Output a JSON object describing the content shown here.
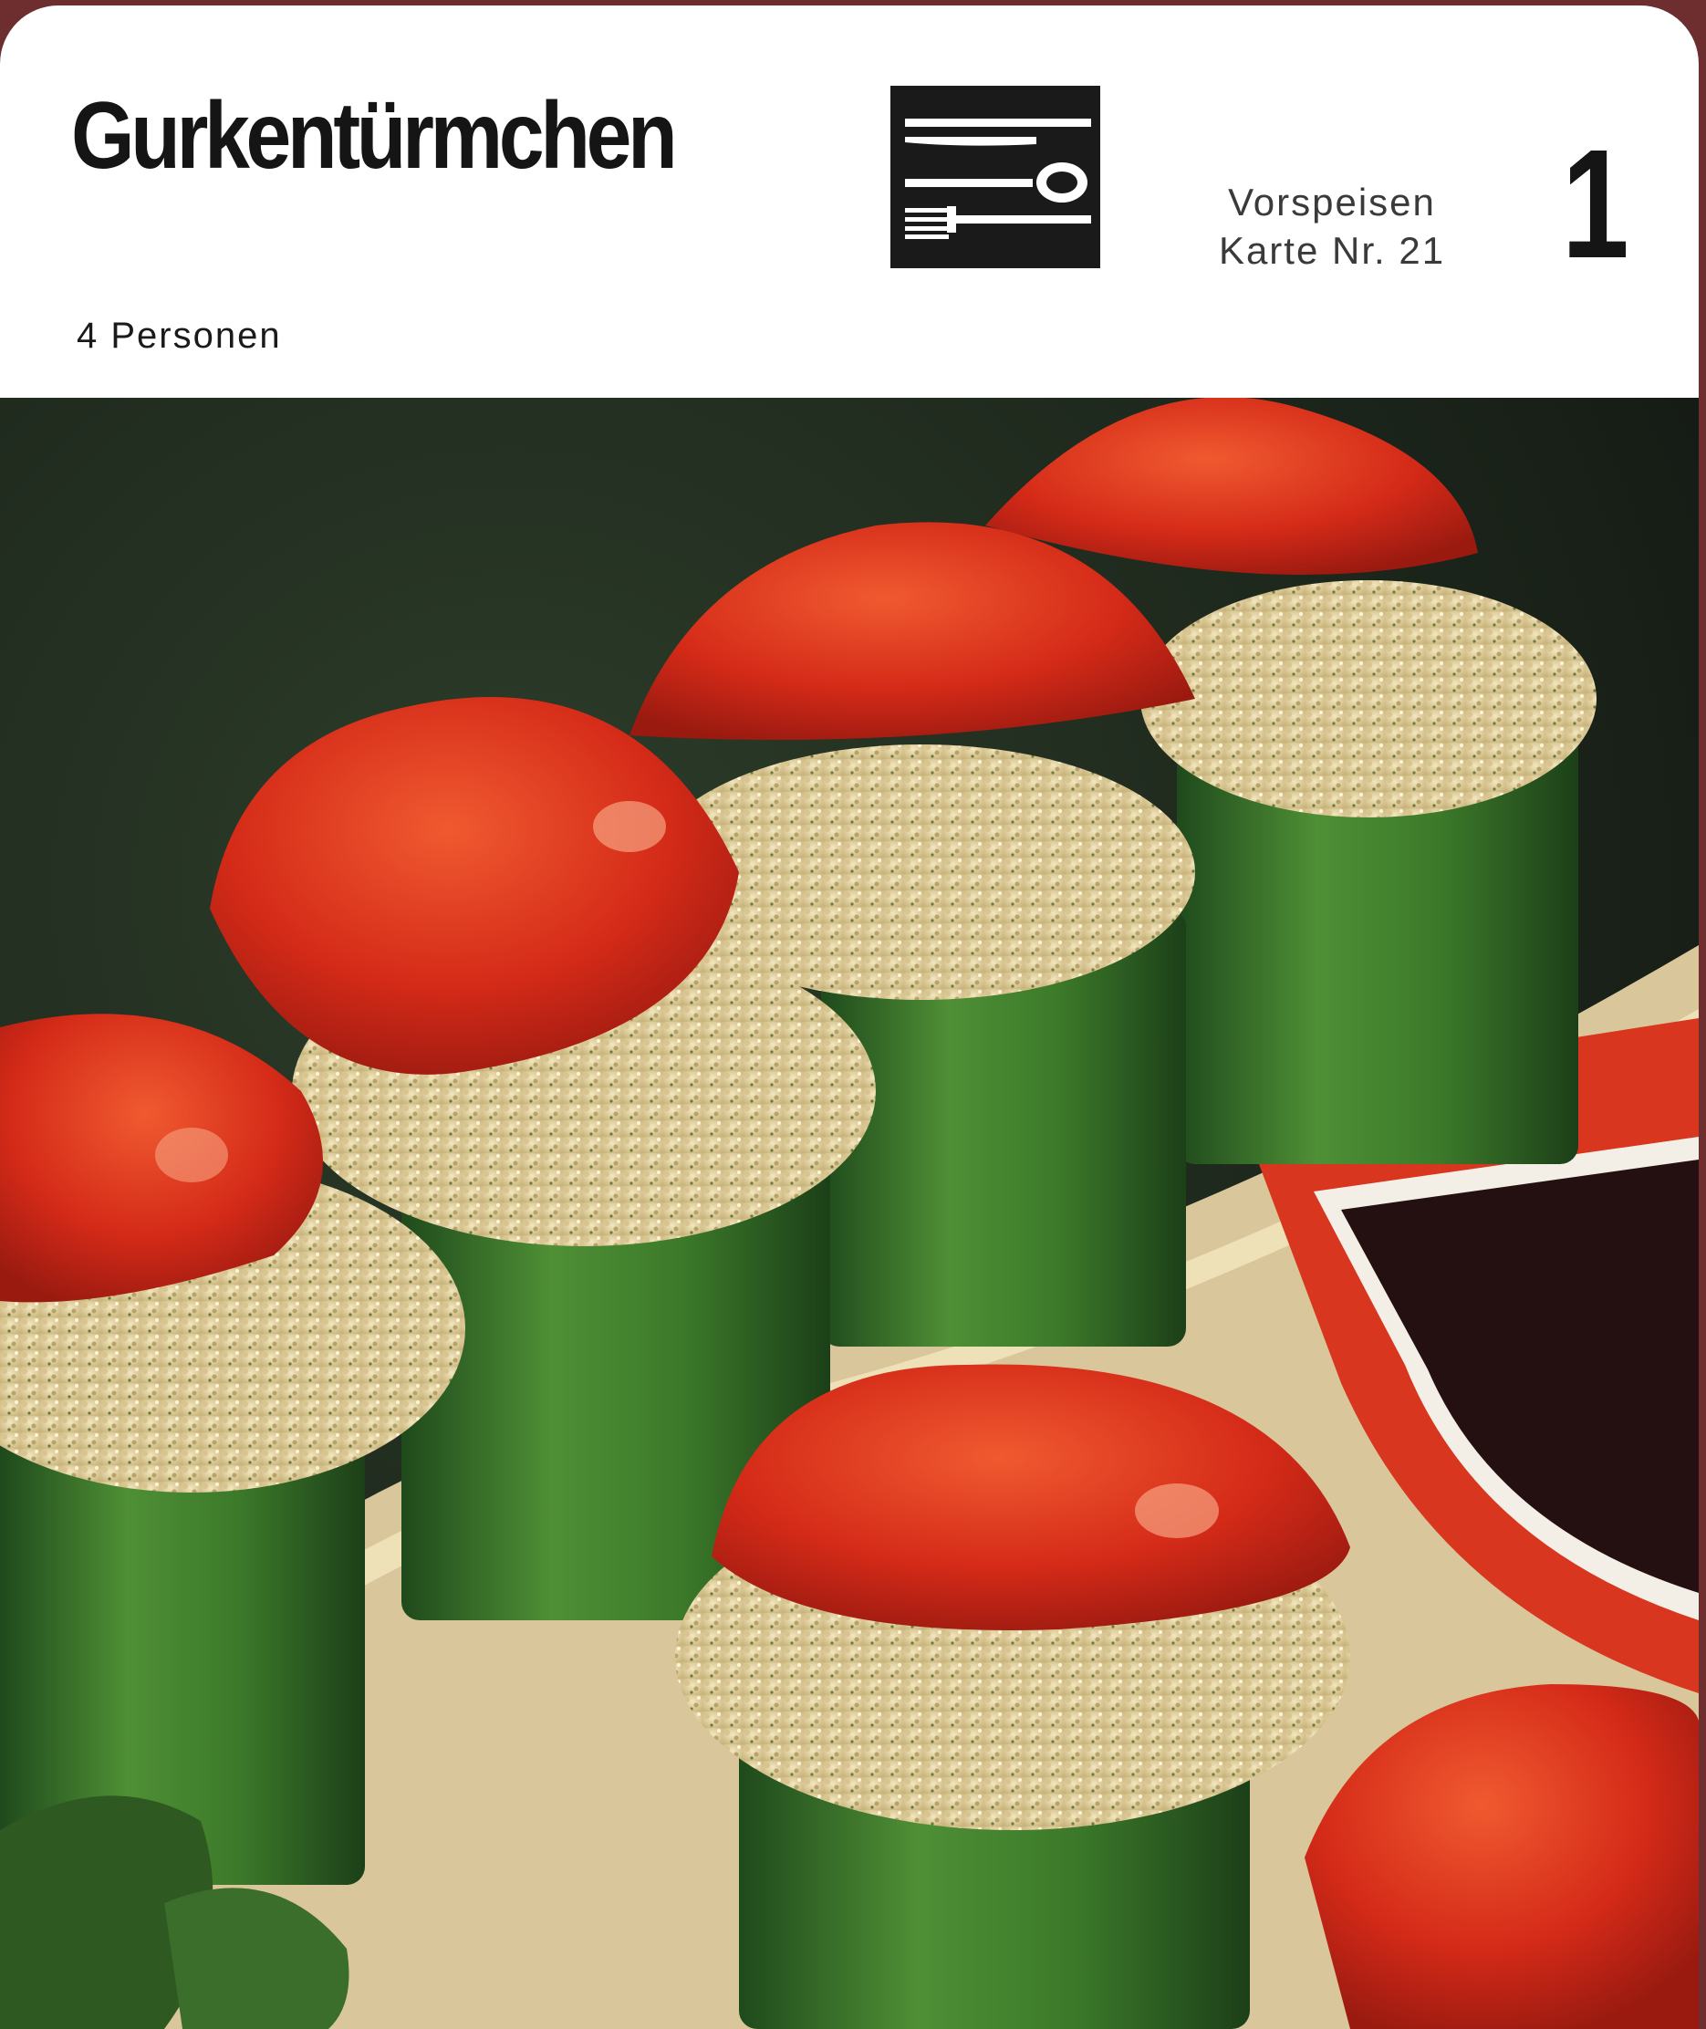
{
  "card": {
    "title": "Gurkentürmchen",
    "servings": "4 Personen",
    "category": "Vorspeisen",
    "card_number": "Karte Nr. 21",
    "section_number": "1",
    "icon": "cutlery-icon"
  },
  "photo": {
    "subject": "cucumber-towers-photo"
  },
  "colors": {
    "border": "#6e2e30",
    "tomato": "#d8311c",
    "cucumber": "#3f7a2c",
    "filling": "#e7d8a9"
  }
}
